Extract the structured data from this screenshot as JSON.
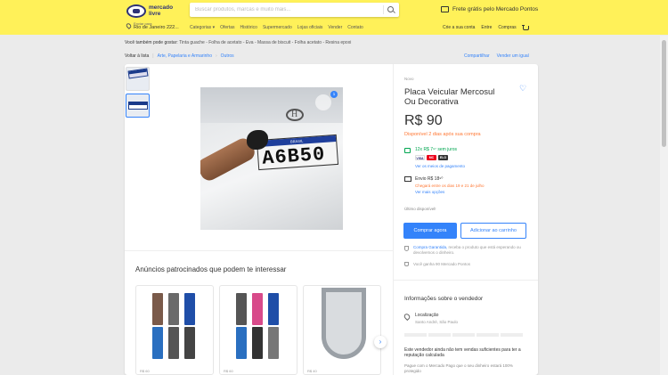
{
  "header": {
    "logo_line1": "mercado",
    "logo_line2": "livre",
    "search_placeholder": "Buscar produtos, marcas e muito mais...",
    "promo": "Frete grátis pelo Mercado Pontos",
    "location_label": "Enviar para",
    "location_city": "Rio de Janeiro 222...",
    "nav": [
      "Categorias ▾",
      "Ofertas",
      "Histórico",
      "Supermercado",
      "Lojas oficiais",
      "Vender",
      "Contato"
    ],
    "user_nav": [
      "Crie a sua conta",
      "Entre",
      "Compras"
    ]
  },
  "related": {
    "label": "Você também pode gostar:",
    "items": "Tinta guache - Folha de acetato - Eva - Massa de biscuit - Folha acetato - Resina epoxi"
  },
  "breadcrumb": {
    "back": "Voltar à lista",
    "path": [
      "Arte, Papelaria e Armarinho",
      "Outros"
    ],
    "share": "Compartilhar",
    "sell_same": "Vender um igual"
  },
  "product": {
    "condition": "Novo",
    "title": "Placa Veicular Mercosul Ou Decorativa",
    "price": "R$ 90",
    "availability": "Disponível 2 dias após sua compra",
    "installments": "12x R$ 7⁹⁷ sem juros",
    "payment_link": "Ver os meios de pagamento",
    "shipping": "Envio R$ 18⁹⁰",
    "shipping_date": "Chegará entre os dias 19 e 21 de julho",
    "shipping_link": "Ver mais opções",
    "last_unit": "Último disponível!",
    "buy_label": "Comprar agora",
    "cart_label": "Adicionar ao carrinho",
    "protect_link": "Compra Garantida,",
    "protect_text": "receba o produto que está esperando ou devolvemos o dinheiro.",
    "points": "Você ganha 90 Mercado Pontos",
    "image_count": "1",
    "plate_band": "BRASIL",
    "plate_text": "A6B50",
    "cards": [
      "VISA",
      "MC",
      "ELO"
    ]
  },
  "seller": {
    "heading": "Informações sobre o vendedor",
    "location_label": "Localização",
    "location_city": "Santo André, São Paulo",
    "message": "Este vendedor ainda não tem vendas suficientes para ter a reputação calculada",
    "note": "Pague com o Mercado Pago que o seu dinheiro estará 100% protegido"
  },
  "ads": {
    "title": "Anúncios patrocinados que podem te interessar",
    "captions": [
      "R$ 60",
      "R$ 60",
      "R$ 40"
    ]
  }
}
